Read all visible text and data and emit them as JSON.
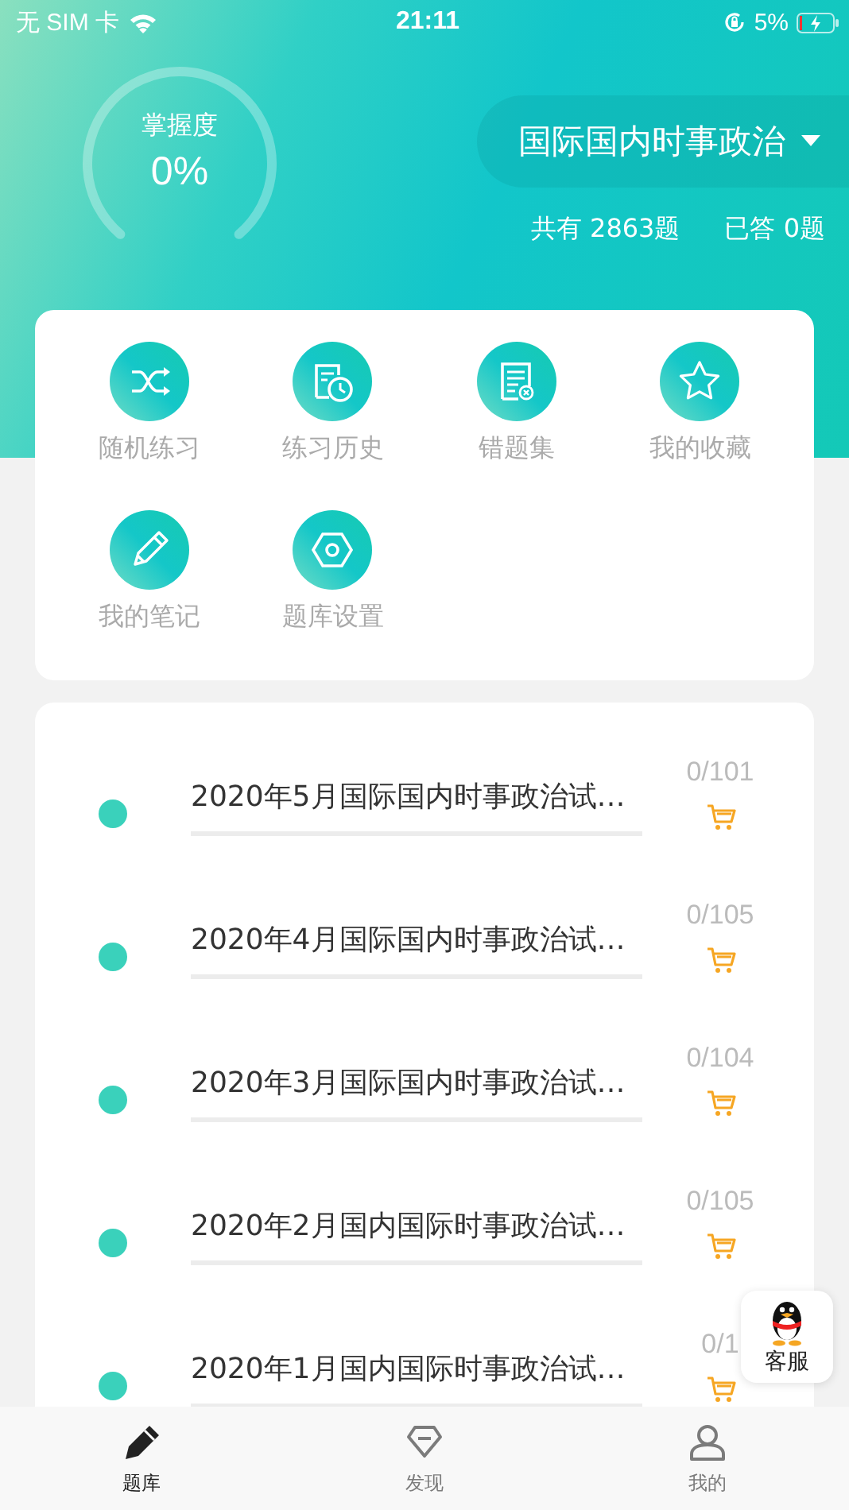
{
  "status_bar": {
    "carrier": "无 SIM 卡",
    "time": "21:11",
    "battery": "5%"
  },
  "header": {
    "mastery_label": "掌握度",
    "mastery_value": "0%",
    "subject": "国际国内时事政治",
    "total": "共有 2863题",
    "answered": "已答 0题"
  },
  "shortcuts": [
    {
      "label": "随机练习"
    },
    {
      "label": "练习历史"
    },
    {
      "label": "错题集"
    },
    {
      "label": "我的收藏"
    },
    {
      "label": "我的笔记"
    },
    {
      "label": "题库设置"
    }
  ],
  "exams": [
    {
      "title": "2020年5月国际国内时事政治试…",
      "count": "0/101",
      "level": 0
    },
    {
      "title": "2020年4月国际国内时事政治试…",
      "count": "0/105",
      "level": 0
    },
    {
      "title": "2020年3月国际国内时事政治试…",
      "count": "0/104",
      "level": 0
    },
    {
      "title": "2020年2月国内国际时事政治试…",
      "count": "0/105",
      "level": 0
    },
    {
      "title": "2020年1月国内国际时事政治试…",
      "count": "0/1",
      "level": 0
    }
  ],
  "support_button": {
    "label": "客服"
  },
  "tabs": [
    {
      "label": "题库",
      "selected": true
    },
    {
      "label": "发现",
      "selected": false
    },
    {
      "label": "我的",
      "selected": false
    }
  ]
}
